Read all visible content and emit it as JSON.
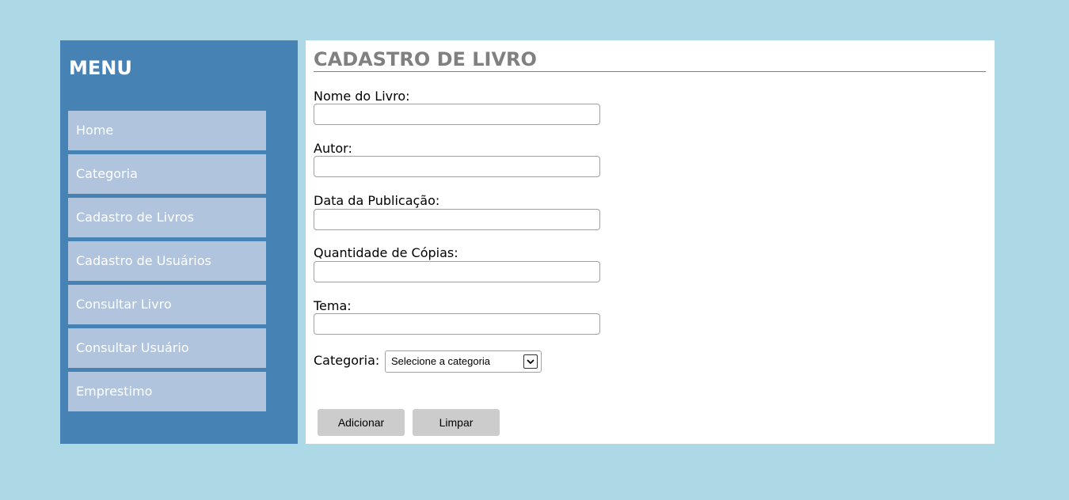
{
  "colors": {
    "page_background": "#add8e6",
    "sidebar_background": "#4682b4",
    "menu_item_background": "#b0c4de",
    "content_background": "#ffffff",
    "title_color": "#808080",
    "button_background": "#cccccc"
  },
  "sidebar": {
    "title": "MENU",
    "items": [
      {
        "label": "Home"
      },
      {
        "label": "Categoria"
      },
      {
        "label": "Cadastro de Livros"
      },
      {
        "label": "Cadastro de Usuários"
      },
      {
        "label": "Consultar Livro"
      },
      {
        "label": "Consultar Usuário"
      },
      {
        "label": "Emprestimo"
      }
    ]
  },
  "form": {
    "title": "CADASTRO DE LIVRO",
    "fields": [
      {
        "label": "Nome do Livro:",
        "value": ""
      },
      {
        "label": "Autor:",
        "value": ""
      },
      {
        "label": "Data da Publicação:",
        "value": ""
      },
      {
        "label": "Quantidade de Cópias:",
        "value": ""
      },
      {
        "label": "Tema:",
        "value": ""
      }
    ],
    "category": {
      "label": "Categoria:",
      "selected": "Selecione a categoria",
      "icon": "chevron-down-icon"
    },
    "buttons": {
      "add": "Adicionar",
      "clear": "Limpar"
    }
  }
}
